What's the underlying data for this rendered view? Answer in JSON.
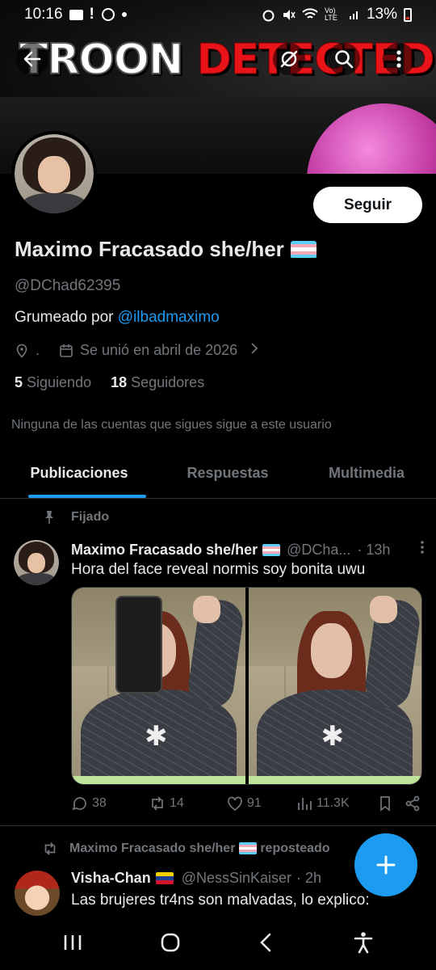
{
  "status_bar": {
    "time": "10:16",
    "network": "Vo) LTE",
    "battery_pct": "13%"
  },
  "banner": {
    "title_white": "TROON ",
    "title_red": "DETECTED"
  },
  "profile": {
    "name": "Maximo Fracasado she/her",
    "handle": "@DChad62395",
    "bio_prefix": "Grumeado por ",
    "bio_link": "@ilbadmaximo",
    "location": ".",
    "joined": "Se unió en abril de 2026",
    "following_count": "5",
    "following_label": "Siguiendo",
    "followers_count": "18",
    "followers_label": "Seguidores",
    "follow_button": "Seguir",
    "notice": "Ninguna de las cuentas que sigues sigue a este usuario"
  },
  "tabs": [
    {
      "label": "Publicaciones",
      "active": true
    },
    {
      "label": "Respuestas",
      "active": false
    },
    {
      "label": "Multimedia",
      "active": false
    }
  ],
  "pinned_post": {
    "pinned_label": "Fijado",
    "author_name": "Maximo Fracasado she/her",
    "author_handle": "@DCha...",
    "time": "· 13h",
    "text": "Hora del face reveal normis soy bonita uwu",
    "replies": "38",
    "reposts": "14",
    "likes": "91",
    "views": "11.3K"
  },
  "repost": {
    "reposter_name": "Maximo Fracasado she/her",
    "reposted_label": "reposteado",
    "author_name": "Visha-Chan",
    "author_handle": "@NessSinKaiser",
    "time": "· 2h",
    "text": "Las brujeres tr4ns son malvadas, lo explico:"
  },
  "colors": {
    "accent": "#1d9bf0",
    "background": "#000000",
    "muted": "#71767b",
    "text": "#e7e9ea",
    "banner_red": "#e8141a"
  },
  "icons": {
    "back": "arrow-left-icon",
    "grok": "grok-icon",
    "search": "search-icon",
    "more": "more-vertical-icon"
  }
}
